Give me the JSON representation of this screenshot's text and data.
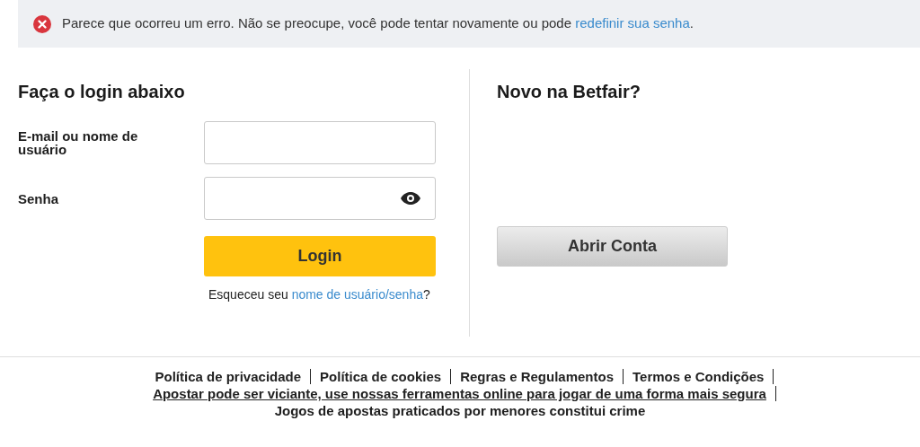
{
  "alert": {
    "kind": "error",
    "text_before": "Parece que ocorreu um erro. Não se preocupe, você pode tentar novamente ou pode ",
    "link": "redefinir sua senha",
    "text_after": "."
  },
  "login": {
    "title": "Faça o login abaixo",
    "fields": [
      {
        "label": "E-mail ou nome de usuário",
        "kind": "text"
      },
      {
        "label": "Senha",
        "kind": "password"
      }
    ],
    "button": "Login",
    "forgot_before": "Esqueceu seu ",
    "forgot_link": "nome de usuário/senha",
    "forgot_after": "?"
  },
  "register": {
    "title": "Novo na Betfair?",
    "button": "Abrir Conta"
  },
  "footer": {
    "lines": [
      {
        "links": [
          {
            "label": "Política de privacidade",
            "underlined": false
          },
          {
            "label": "Política de cookies",
            "underlined": false
          },
          {
            "label": "Regras e Regulamentos",
            "underlined": false
          },
          {
            "label": "Termos e Condições",
            "underlined": false
          }
        ]
      },
      {
        "links": [
          {
            "label": "Apostar pode ser viciante, use nossas ferramentas online para jogar de uma forma mais segura",
            "underlined": true
          }
        ]
      }
    ],
    "notice": "Jogos de apostas praticados por menores constitui crime"
  }
}
